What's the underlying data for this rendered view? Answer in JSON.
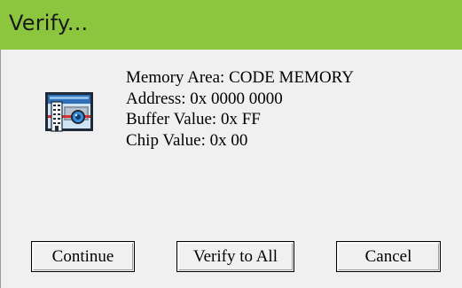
{
  "window": {
    "title": "Verify..."
  },
  "icon": {
    "name": "chip-verify-icon"
  },
  "info": {
    "memory_area": "Memory Area: CODE MEMORY",
    "address": "Address: 0x 0000 0000",
    "buffer_value": "Buffer Value: 0x FF",
    "chip_value": "Chip Value: 0x 00"
  },
  "buttons": {
    "continue_label": "Continue",
    "verify_all_label": "Verify to All",
    "cancel_label": "Cancel"
  },
  "colors": {
    "titlebar": "#8cc63f",
    "background": "#f0f0f0"
  }
}
